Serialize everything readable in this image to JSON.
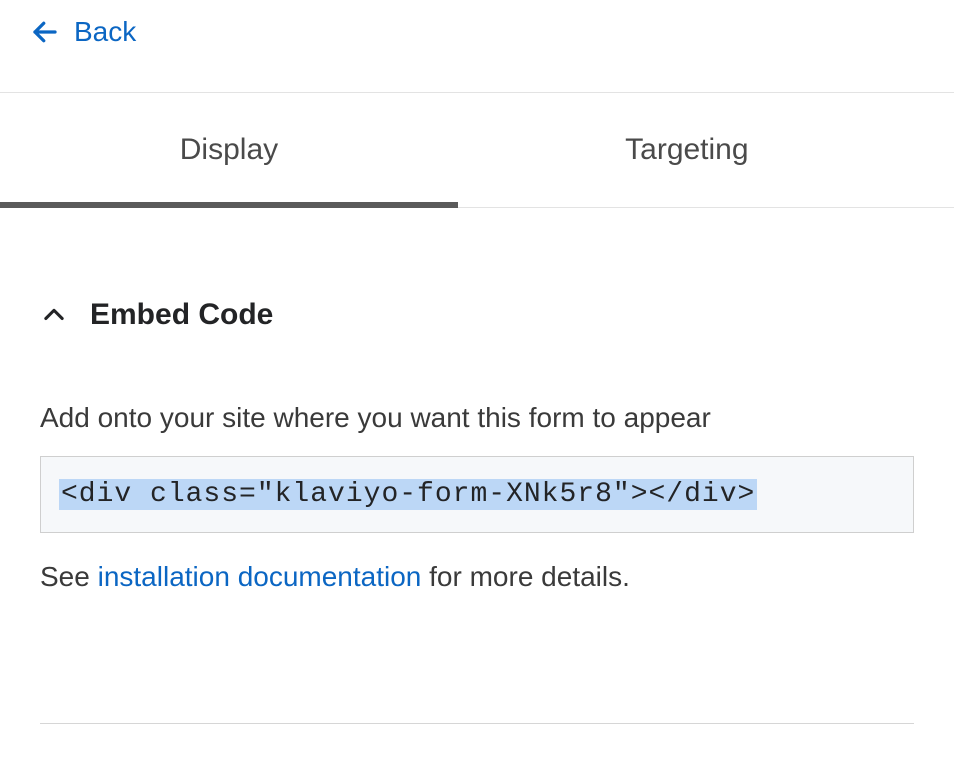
{
  "header": {
    "back_label": "Back"
  },
  "tabs": {
    "display_label": "Display",
    "targeting_label": "Targeting"
  },
  "section": {
    "title": "Embed Code",
    "subtitle": "Add onto your site where you want this form to appear",
    "code_snippet": "<div class=\"klaviyo-form-XNk5r8\"></div>",
    "helper_prefix": "See ",
    "helper_link": "installation documentation",
    "helper_suffix": " for more details."
  }
}
